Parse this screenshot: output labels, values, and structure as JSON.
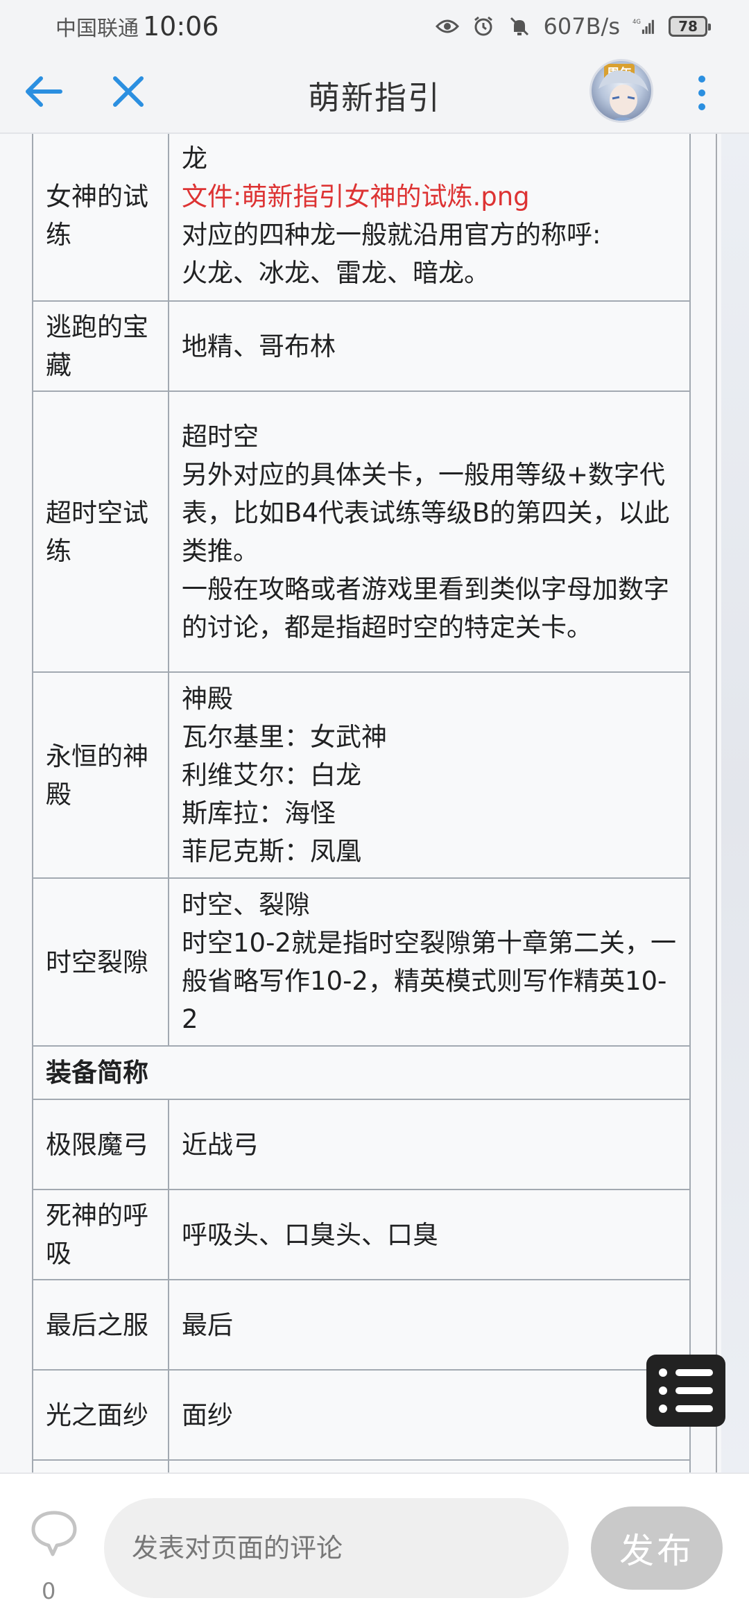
{
  "status_bar": {
    "carrier": "中国联通",
    "time": "10:06",
    "net_speed": "607B/s",
    "network": "4G",
    "battery": "78"
  },
  "header": {
    "title": "萌新指引",
    "avatar_badge": "周年"
  },
  "table": {
    "rows": [
      {
        "key": "女神的试练",
        "lines": [
          "龙"
        ],
        "file_link": "文件:萌新指引女神的试炼.png",
        "lines_after": [
          "对应的四种龙一般就沿用官方的称呼:",
          "火龙、冰龙、雷龙、暗龙。"
        ]
      },
      {
        "key": "逃跑的宝藏",
        "lines": [
          "地精、哥布林"
        ]
      },
      {
        "key": "超时空试练",
        "lines": [
          "超时空",
          "另外对应的具体关卡，一般用等级+数字代表，比如B4代表试练等级B的第四关，以此类推。",
          "一般在攻略或者游戏里看到类似字母加数字的讨论，都是指超时空的特定关卡。"
        ]
      },
      {
        "key": "永恒的神殿",
        "lines": [
          "神殿",
          "瓦尔基里：女武神",
          "利维艾尔：白龙",
          "斯库拉：海怪",
          "菲尼克斯：凤凰"
        ]
      },
      {
        "key": "时空裂隙",
        "lines": [
          "时空、裂隙",
          "时空10-2就是指时空裂隙第十章第二关，一般省略写作10-2，精英模式则写作精英10-2"
        ]
      }
    ],
    "section_title": "装备简称",
    "equip_rows": [
      {
        "key": "极限魔弓",
        "value": "近战弓"
      },
      {
        "key": "死神的呼吸",
        "value": "呼吸头、口臭头、口臭"
      },
      {
        "key": "最后之服",
        "value": "最后"
      },
      {
        "key": "光之面纱",
        "value": "面纱"
      }
    ]
  },
  "bottom": {
    "comment_count": "0",
    "comment_placeholder": "发表对页面的评论",
    "publish_label": "发布"
  },
  "colors": {
    "accent": "#2b8fe0",
    "file_link": "#dd3333",
    "border": "#a2a9b1"
  }
}
